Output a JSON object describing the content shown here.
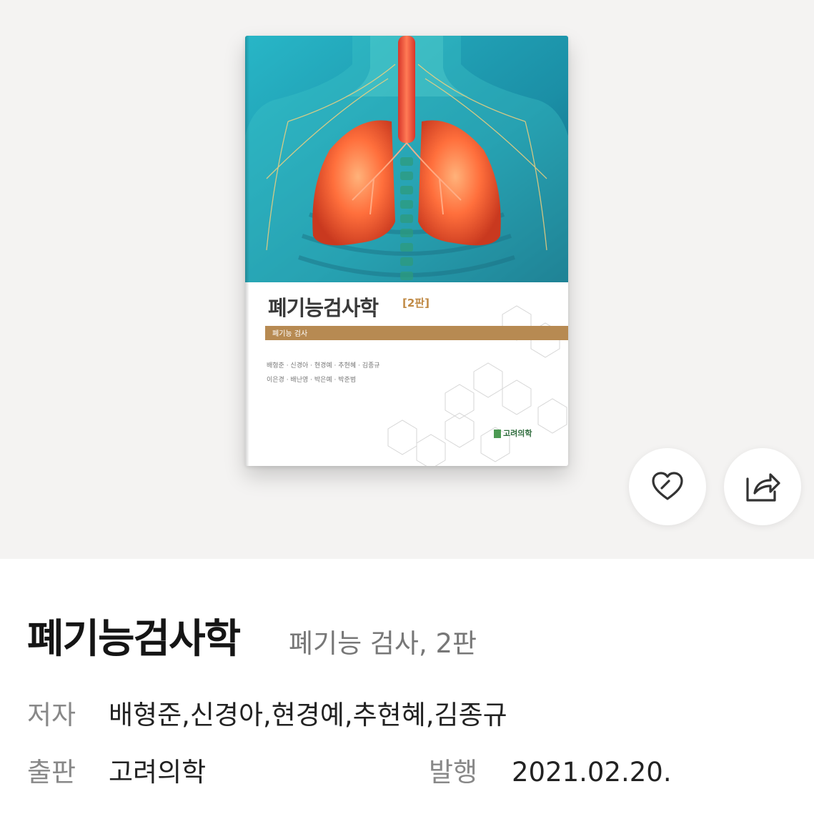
{
  "cover": {
    "title": "폐기능검사학",
    "edition": "[2판]",
    "band_label": "폐기능 검사",
    "authors_line1": "배형준 · 신경아 · 현경예 · 추현혜 · 김종규",
    "authors_line2": "이은경 · 배난영 · 박은예 · 박준범",
    "publisher": "고려의학"
  },
  "actions": {
    "like_icon": "heart-outline-icon",
    "share_icon": "share-arrow-icon"
  },
  "book": {
    "title": "폐기능검사학",
    "subtitle": "폐기능 검사, 2판",
    "author_label": "저자",
    "authors": "배형준,신경아,현경예,추현혜,김종규",
    "publisher_label": "출판",
    "publisher": "고려의학",
    "published_label": "발행",
    "published_date": "2021.02.20."
  },
  "colors": {
    "hero_background": "#f4f3f2",
    "cover_teal": "#1f9db0",
    "lung_orange": "#ff6a3a",
    "band_gold": "#b78a52"
  }
}
